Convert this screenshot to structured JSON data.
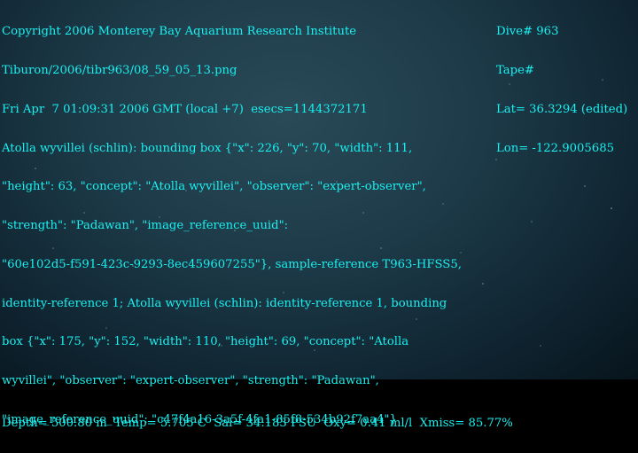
{
  "image": {
    "description_icon": "deep-sea-water-column"
  },
  "overlay_left": [
    "Copyright 2006 Monterey Bay Aquarium Research Institute",
    "Tiburon/2006/tibr963/08_59_05_13.png",
    "Fri Apr  7 01:09:31 2006 GMT (local +7)  esecs=1144372171",
    "Atolla wyvillei (schlin): bounding box {\"x\": 226, \"y\": 70, \"width\": 111,",
    "\"height\": 63, \"concept\": \"Atolla wyvillei\", \"observer\": \"expert-observer\",",
    "\"strength\": \"Padawan\", \"image_reference_uuid\":",
    "\"60e102d5-f591-423c-9293-8ec459607255\"}, sample-reference T963-HFSS5,",
    "identity-reference 1; Atolla wyvillei (schlin): identity-reference 1, bounding",
    "box {\"x\": 175, \"y\": 152, \"width\": 110, \"height\": 69, \"concept\": \"Atolla",
    "wyvillei\", \"observer\": \"expert-observer\", \"strength\": \"Padawan\",",
    "\"image_reference_uuid\": \"c47f4a16-3a5f-4fa1-85f8-534b92f7aa4\"}"
  ],
  "overlay_right": [
    "Dive# 963",
    "Tape#",
    "Lat= 36.3294 (edited)",
    "Lon= -122.9005685"
  ],
  "overlay_bottom": "Depth= 500.80 m  Temp= 5.705 C  Sal= 34.183 PSU  Oxy= 0.41 ml/l  Xmiss= 85.77%",
  "colors": {
    "overlay_text": "#19f0f0",
    "water": "#1d3a48"
  }
}
